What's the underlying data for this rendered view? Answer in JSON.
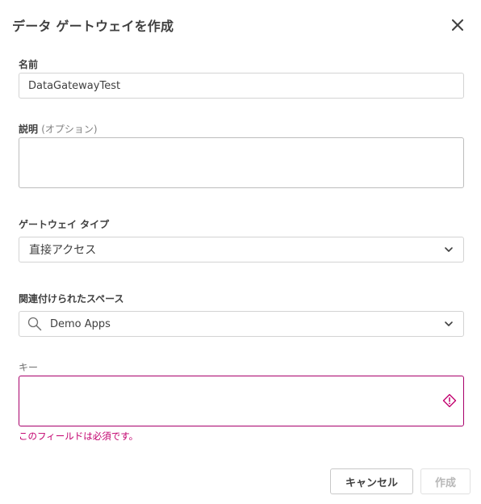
{
  "dialog": {
    "title": "データ ゲートウェイを作成"
  },
  "form": {
    "name": {
      "label": "名前",
      "value": "DataGatewayTest"
    },
    "description": {
      "label": "説明",
      "optional_label": "(オプション)",
      "value": ""
    },
    "gateway_type": {
      "label": "ゲートウェイ タイプ",
      "selected": "直接アクセス"
    },
    "space": {
      "label": "関連付けられたスペース",
      "selected": "Demo Apps",
      "icon": "search-icon"
    },
    "key": {
      "label": "キー",
      "value": "",
      "error": "このフィールドは必須です。",
      "error_color": "#c2006e"
    }
  },
  "actions": {
    "cancel_label": "キャンセル",
    "create_label": "作成"
  }
}
